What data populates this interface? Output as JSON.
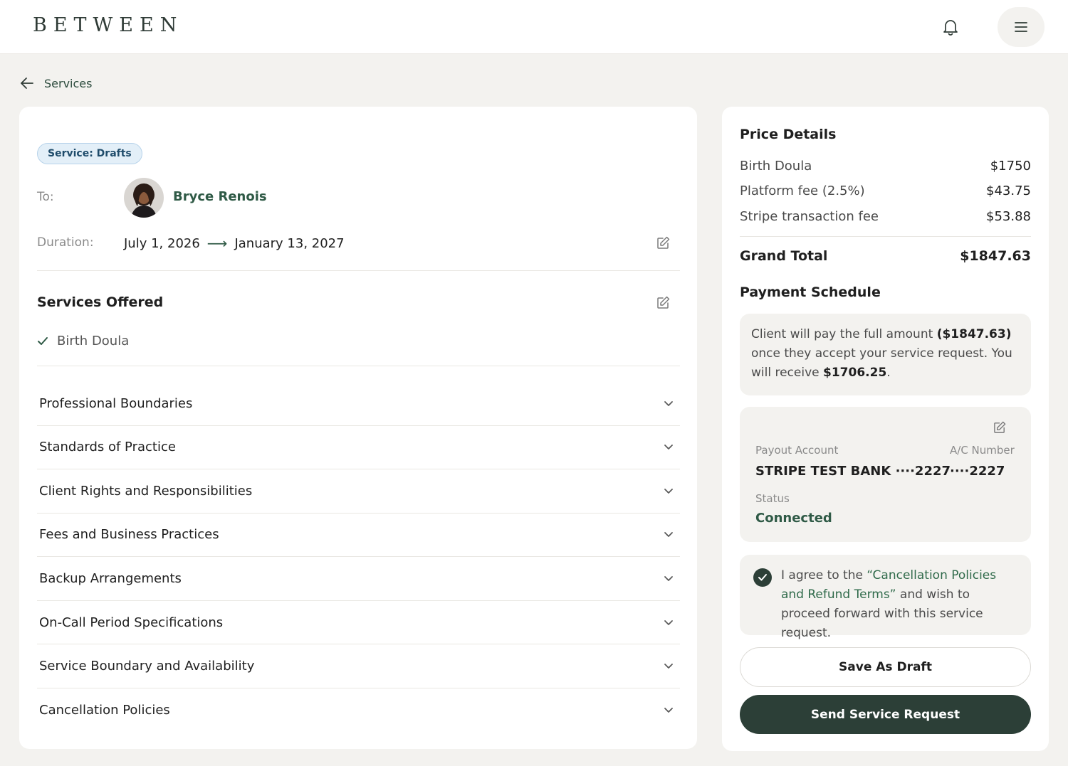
{
  "app": {
    "logo": "BETWEEN"
  },
  "header": {
    "bell_icon": "bell-icon",
    "menu_icon": "hamburger-menu-icon"
  },
  "breadcrumb": {
    "back_label": "Services"
  },
  "service": {
    "badge": "Service: Drafts",
    "to_label": "To:",
    "recipient_name": "Bryce Renois",
    "duration_label": "Duration:",
    "start_date": "July 1, 2026",
    "end_date": "January 13, 2027",
    "arrow": "⟶",
    "services_offered_title": "Services Offered",
    "services_offered": [
      "Birth Doula"
    ]
  },
  "sections": [
    {
      "label": "Professional Boundaries"
    },
    {
      "label": "Standards of Practice"
    },
    {
      "label": "Client Rights and Responsibilities"
    },
    {
      "label": "Fees and Business Practices"
    },
    {
      "label": "Backup Arrangements"
    },
    {
      "label": "On-Call Period Specifications"
    },
    {
      "label": "Service Boundary and Availability"
    },
    {
      "label": "Cancellation Policies"
    }
  ],
  "price": {
    "title": "Price Details",
    "rows": [
      {
        "label": "Birth Doula",
        "amount": "$1750"
      },
      {
        "label": "Platform fee (2.5%)",
        "amount": "$43.75"
      },
      {
        "label": "Stripe transaction fee",
        "amount": "$53.88"
      }
    ],
    "total_label": "Grand Total",
    "total_amount": "$1847.63"
  },
  "schedule": {
    "title": "Payment Schedule",
    "text_1": "Client will pay the full amount ",
    "full_amount": "($1847.63)",
    "text_2": " once they accept your service request. You will receive ",
    "receive_amount": "$1706.25",
    "text_3": "."
  },
  "payout": {
    "account_label": "Payout Account",
    "account_value": "STRIPE TEST BANK ····2227",
    "ac_label": "A/C Number",
    "ac_value": "····2227",
    "status_label": "Status",
    "status_value": "Connected"
  },
  "agreement": {
    "checked": true,
    "prefix": "I agree to the ",
    "link": "“Cancellation Policies and Refund Terms”",
    "suffix": " and wish to proceed forward with this service request."
  },
  "actions": {
    "save_draft": "Save As Draft",
    "send_request": "Send Service Request"
  },
  "colors": {
    "accent_dark": "#2c3f37",
    "accent_green": "#2f5a46",
    "badge_bg": "#e3eff8",
    "page_bg": "#f3f2ef"
  }
}
